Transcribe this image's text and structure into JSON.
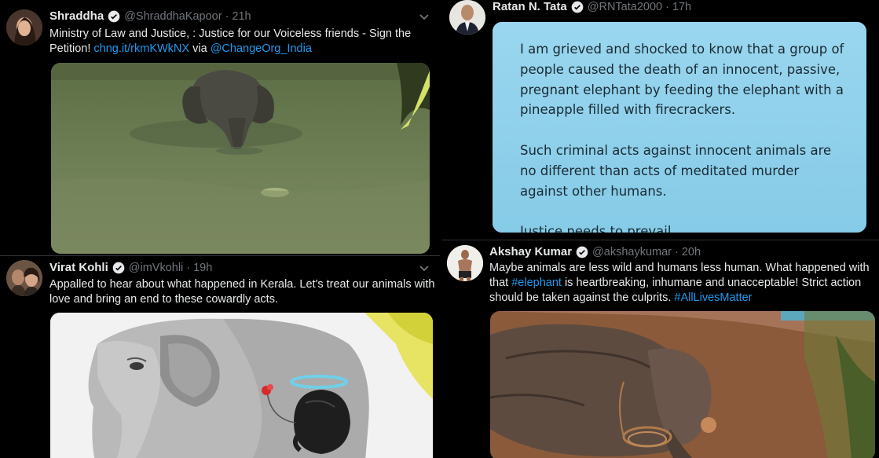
{
  "tweets": [
    {
      "name": "Shraddha",
      "handle": "@ShraddhaKapoor",
      "time": "21h",
      "text_1": "Ministry of Law and Justice, : Justice for our Voiceless friends - Sign the",
      "text_2_plain": "Petition! ",
      "link_1": "chng.it/rkmKWkNX",
      "text_2_mid": " via ",
      "link_2": "@ChangeOrg_India",
      "media": "elephant-standing-in-river-photo"
    },
    {
      "name": "Ratan N. Tata",
      "handle": "@RNTata2000",
      "time": "17h",
      "card_lines": [
        "I am grieved and shocked to know that a group of",
        "people caused the death of an innocent, passive,",
        "pregnant elephant by feeding the elephant with a",
        "pineapple filled with firecrackers.",
        "",
        "Such criminal acts against innocent animals are",
        "no different than acts of meditated murder",
        "against other humans.",
        "",
        "Justice needs to prevail."
      ]
    },
    {
      "name": "Virat Kohli",
      "handle": "@imVkohli",
      "time": "19h",
      "text_1": "Appalled to hear about what happened in Kerala. Let's treat our animals with",
      "text_2": "love and bring an end to these cowardly acts.",
      "media": "elephant-with-calf-illustration"
    },
    {
      "name": "Akshay Kumar",
      "handle": "@akshaykumar",
      "time": "20h",
      "text_1": "Maybe animals are less wild and humans less human. What happened with",
      "text_2_plain": "that ",
      "hashtag_1": "#elephant",
      "text_2_rest": " is heartbreaking, inhumane and unacceptable! Strict action",
      "text_3_plain": "should be taken against the culprits. ",
      "hashtag_2": "#AllLivesMatter",
      "media": "dead-elephant-on-ground-photo"
    }
  ],
  "separator": "·",
  "colors": {
    "background": "#000000",
    "name": "#e7e9ea",
    "muted": "#71767b",
    "link": "#1d9bf0",
    "verified": "#1d9bf0",
    "card_bg": "#8fd1ec"
  }
}
